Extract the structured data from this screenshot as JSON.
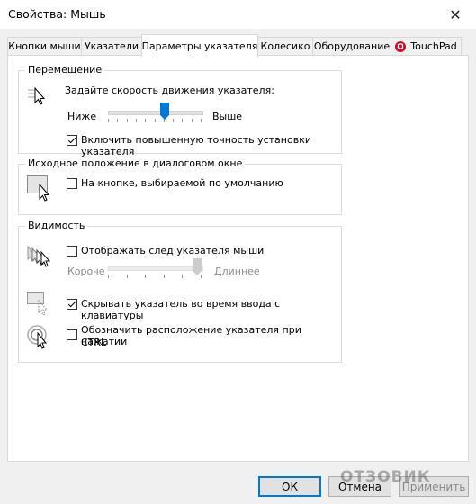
{
  "window": {
    "title": "Свойства: Мышь",
    "close_glyph": "✕"
  },
  "tabs": [
    {
      "label": "Кнопки мыши"
    },
    {
      "label": "Указатели"
    },
    {
      "label": "Параметры указателя"
    },
    {
      "label": "Колесико"
    },
    {
      "label": "Оборудование"
    },
    {
      "label": "TouchPad",
      "icon": "touchpad-icon"
    }
  ],
  "movement": {
    "group_label": "Перемещение",
    "speed_label": "Задайте скорость движения указателя:",
    "slow_label": "Ниже",
    "fast_label": "Выше",
    "speed_level": 0.62,
    "precision_label": "Включить повышенную точность установки указателя",
    "precision_checked": true
  },
  "snap": {
    "group_label": "Исходное положение в диалоговом окне",
    "snap_label": "На кнопке, выбираемой по умолчанию",
    "snap_checked": false
  },
  "visibility": {
    "group_label": "Видимость",
    "trails_label": "Отображать след указателя мыши",
    "trails_checked": false,
    "short_label": "Короче",
    "long_label": "Длиннее",
    "trail_level": 1.0,
    "hide_label": "Скрывать указатель во время ввода с клавиатуры",
    "hide_checked": true,
    "ctrl_label_line1": "Обозначить расположение указателя при нажатии",
    "ctrl_label_line2": "CTRL",
    "ctrl_checked": false
  },
  "buttons": {
    "ok": "ОК",
    "cancel": "Отмена",
    "apply": "Применить"
  },
  "watermark": "ОТЗОВИК",
  "colors": {
    "accent": "#0078d7"
  }
}
